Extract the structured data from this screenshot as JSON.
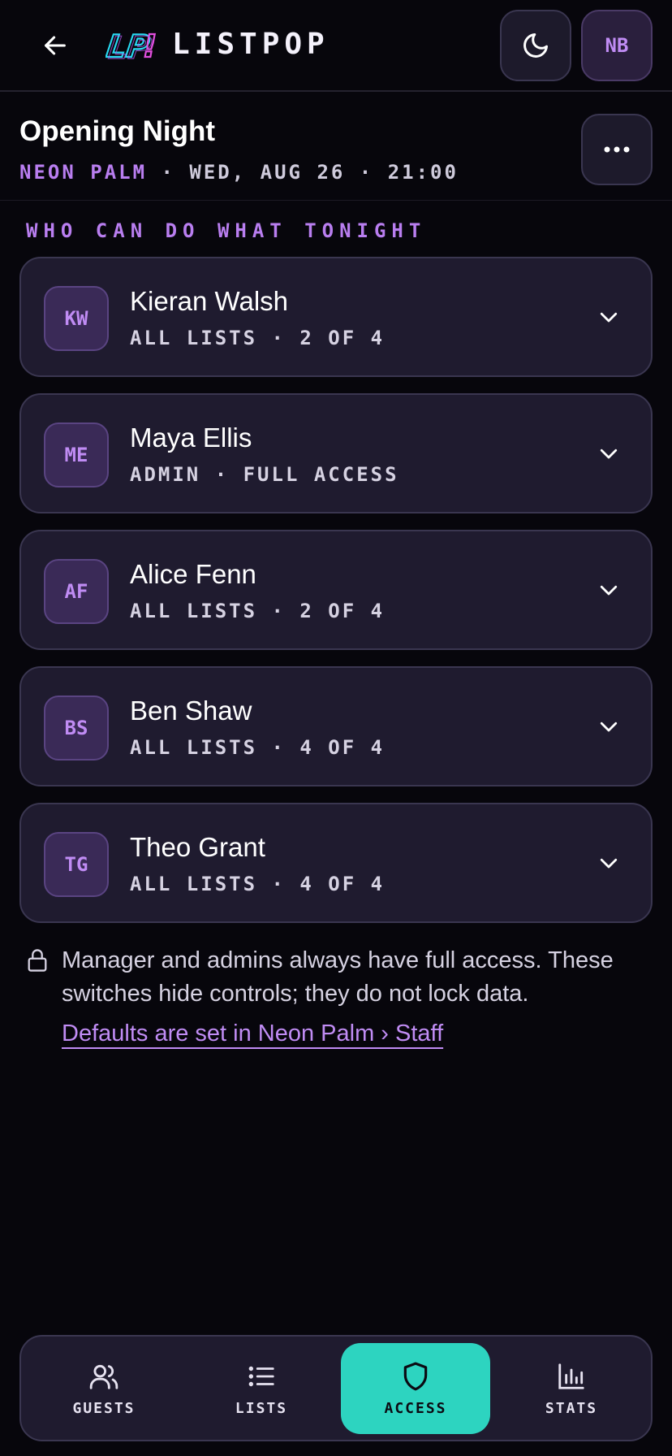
{
  "header": {
    "brand": "LISTPOP",
    "logo_text": "LP!",
    "user_initials": "NB"
  },
  "event": {
    "title": "Opening Night",
    "venue": "NEON PALM",
    "schedule": "· WED, AUG 26 · 21:00"
  },
  "section_title": "WHO CAN DO WHAT TONIGHT",
  "staff": [
    {
      "initials": "KW",
      "name": "Kieran Walsh",
      "access": "ALL LISTS · 2 OF 4"
    },
    {
      "initials": "ME",
      "name": "Maya Ellis",
      "access": "ADMIN · FULL ACCESS"
    },
    {
      "initials": "AF",
      "name": "Alice Fenn",
      "access": "ALL LISTS · 2 OF 4"
    },
    {
      "initials": "BS",
      "name": "Ben Shaw",
      "access": "ALL LISTS · 4 OF 4"
    },
    {
      "initials": "TG",
      "name": "Theo Grant",
      "access": "ALL LISTS · 4 OF 4"
    }
  ],
  "note": {
    "text": "Manager and admins always have full access. These switches hide controls; they do not lock data.",
    "link": "Defaults are set in Neon Palm › Staff"
  },
  "nav": {
    "items": [
      {
        "label": "GUESTS",
        "icon": "users-icon"
      },
      {
        "label": "LISTS",
        "icon": "list-icon"
      },
      {
        "label": "ACCESS",
        "icon": "shield-icon",
        "active": true
      },
      {
        "label": "STATS",
        "icon": "bar-chart-icon"
      }
    ]
  },
  "colors": {
    "background": "#07060c",
    "card": "#1f1b2f",
    "accent_purple": "#b97ef0",
    "accent_teal": "#2dd4c0"
  }
}
